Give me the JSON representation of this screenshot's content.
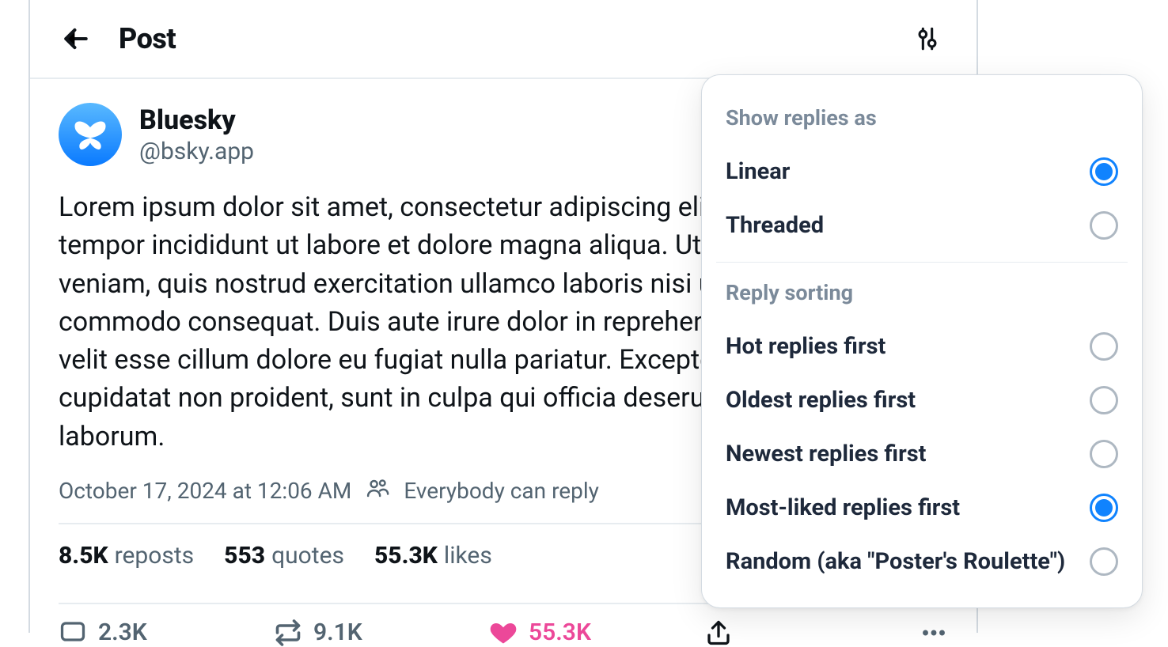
{
  "header": {
    "title": "Post"
  },
  "post": {
    "author_name": "Bluesky",
    "author_handle": "@bsky.app",
    "body": "Lorem ipsum dolor sit amet, consectetur adipiscing elit, sed do eiusmod tempor incididunt ut labore et dolore magna aliqua. Ut enim ad minim veniam, quis nostrud exercitation ullamco laboris nisi ut aliquip ex ea commodo consequat. Duis aute irure dolor in reprehenderit in voluptate velit esse cillum dolore eu fugiat nulla pariatur. Excepteur sint occaecat cupidatat non proident, sunt in culpa qui officia deserunt mollit anim id est laborum.",
    "timestamp": "October 17, 2024 at 12:06 AM",
    "reply_scope": "Everybody can reply",
    "metrics": {
      "reposts_count": "8.5K",
      "reposts_label": "reposts",
      "quotes_count": "553",
      "quotes_label": "quotes",
      "likes_count": "55.3K",
      "likes_label": "likes"
    },
    "actions": {
      "reply_count": "2.3K",
      "repost_count": "9.1K",
      "like_count": "55.3K"
    }
  },
  "popover": {
    "section1_title": "Show replies as",
    "display_options": [
      {
        "label": "Linear",
        "selected": true
      },
      {
        "label": "Threaded",
        "selected": false
      }
    ],
    "section2_title": "Reply sorting",
    "sort_options": [
      {
        "label": "Hot replies first",
        "selected": false
      },
      {
        "label": "Oldest replies first",
        "selected": false
      },
      {
        "label": "Newest replies first",
        "selected": false
      },
      {
        "label": "Most-liked replies first",
        "selected": true
      },
      {
        "label": "Random (aka \"Poster's Roulette\")",
        "selected": false
      }
    ]
  }
}
